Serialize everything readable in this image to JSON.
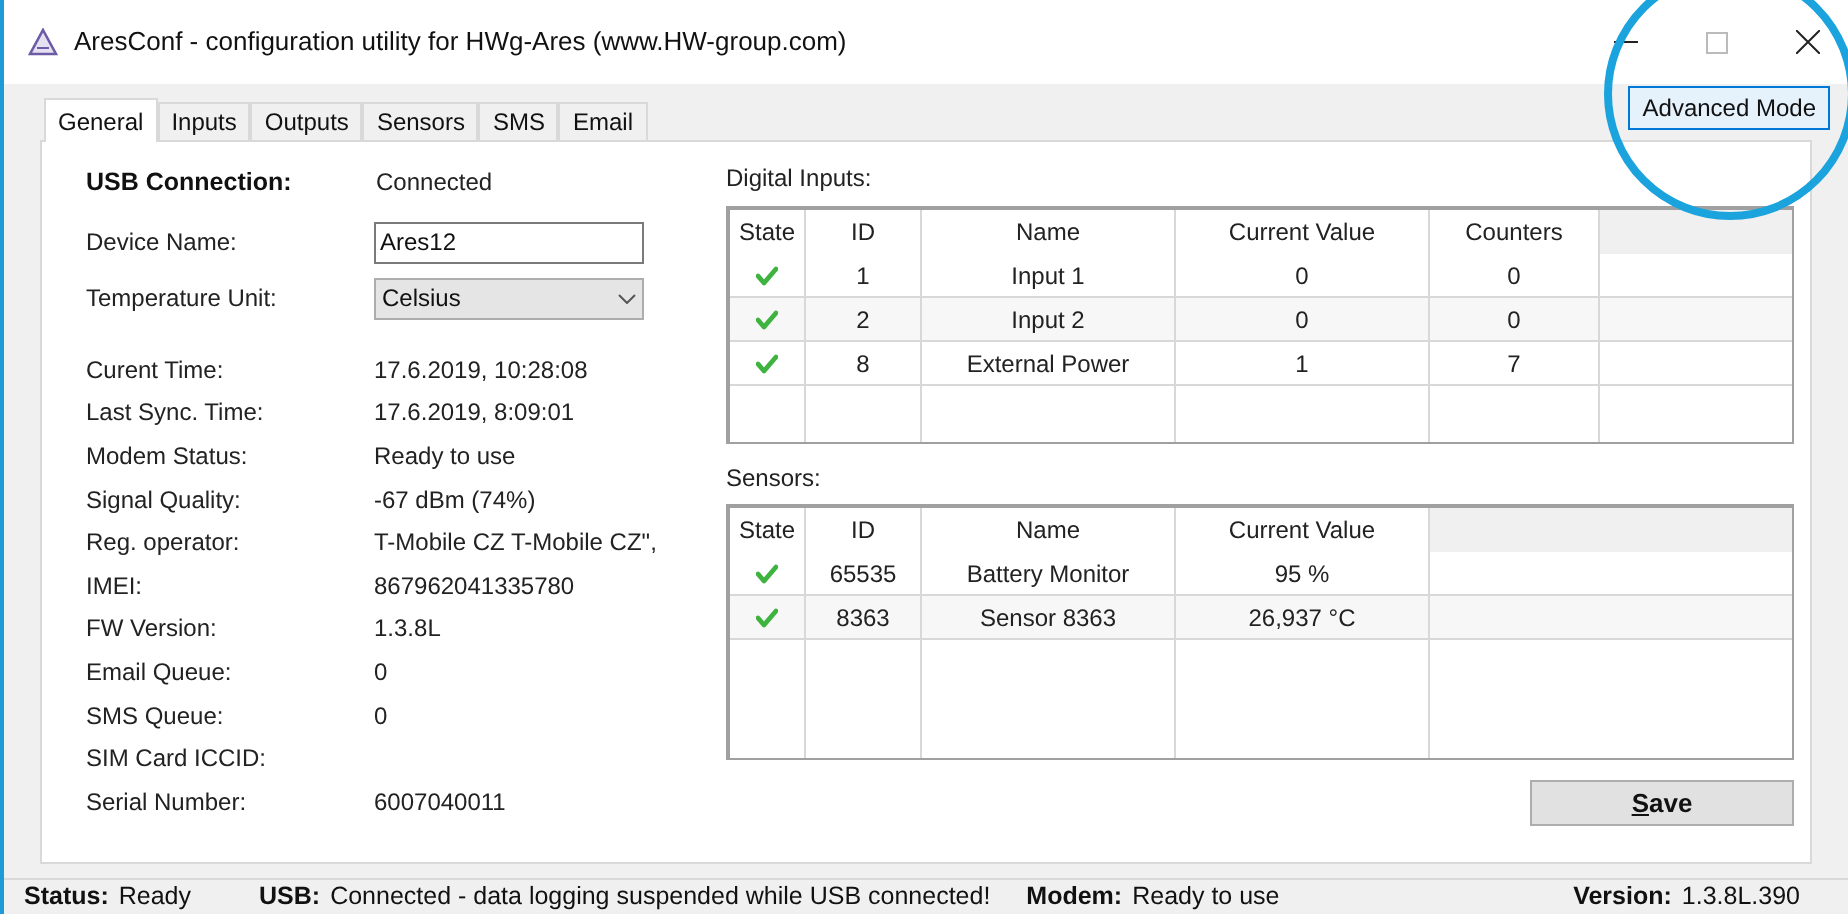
{
  "window": {
    "title": "AresConf - configuration utility for HWg-Ares (www.HW-group.com)"
  },
  "advanced_button": "Advanced Mode",
  "tabs": [
    {
      "label": "General",
      "selected": true
    },
    {
      "label": "Inputs",
      "selected": false
    },
    {
      "label": "Outputs",
      "selected": false
    },
    {
      "label": "Sensors",
      "selected": false
    },
    {
      "label": "SMS",
      "selected": false
    },
    {
      "label": "Email",
      "selected": false
    }
  ],
  "usb_connection": {
    "label": "USB Connection:",
    "value": "Connected"
  },
  "device_name": {
    "label": "Device Name:",
    "value": "Ares12"
  },
  "temperature_unit": {
    "label": "Temperature Unit:",
    "value": "Celsius"
  },
  "info": [
    {
      "label": "Curent Time:",
      "value": "17.6.2019, 10:28:08"
    },
    {
      "label": "Last Sync. Time:",
      "value": "17.6.2019, 8:09:01"
    },
    {
      "label": "Modem Status:",
      "value": "Ready to use"
    },
    {
      "label": "Signal Quality:",
      "value": "-67 dBm (74%)"
    },
    {
      "label": "Reg. operator:",
      "value": "T-Mobile CZ T-Mobile CZ\","
    },
    {
      "label": "IMEI:",
      "value": "867962041335780"
    },
    {
      "label": "FW Version:",
      "value": "1.3.8L"
    },
    {
      "label": "Email Queue:",
      "value": "0"
    },
    {
      "label": "SMS Queue:",
      "value": "0"
    },
    {
      "label": "SIM Card ICCID:"
    },
    {
      "label": "Serial Number:",
      "value": "6007040011"
    }
  ],
  "digital_inputs": {
    "title": "Digital Inputs:",
    "columns": [
      "State",
      "ID",
      "Name",
      "Current Value",
      "Counters"
    ],
    "rows": [
      {
        "ok": true,
        "cells": [
          "",
          "1",
          "Input 1",
          "0",
          "0"
        ]
      },
      {
        "ok": true,
        "cells": [
          "",
          "2",
          "Input 2",
          "0",
          "0"
        ]
      },
      {
        "ok": true,
        "cells": [
          "",
          "8",
          "External Power",
          "1",
          "7"
        ]
      }
    ]
  },
  "sensors": {
    "title": "Sensors:",
    "columns": [
      "State",
      "ID",
      "Name",
      "Current Value"
    ],
    "rows": [
      {
        "ok": true,
        "cells": [
          "",
          "65535",
          "Battery Monitor",
          "95 %"
        ]
      },
      {
        "ok": true,
        "cells": [
          "",
          "8363",
          "Sensor 8363",
          "26,937 °C"
        ]
      }
    ]
  },
  "save_button": "Save",
  "status_bar": [
    {
      "label": "Status:",
      "value": "Ready"
    },
    {
      "label": "USB:",
      "value": "Connected - data logging suspended while USB connected!"
    },
    {
      "label": "Modem:",
      "value": "Ready to use"
    },
    {
      "label": "Version:",
      "value": "1.3.8L.390"
    }
  ]
}
